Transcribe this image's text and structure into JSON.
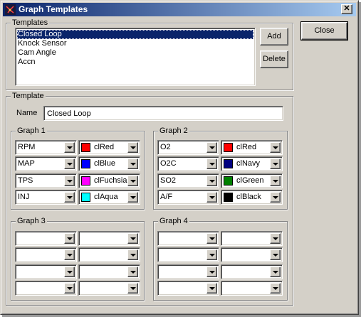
{
  "window": {
    "title": "Graph Templates",
    "close_glyph": "✕"
  },
  "buttons": {
    "close": "Close",
    "add": "Add",
    "delete": "Delete"
  },
  "templates_group": {
    "label": "Templates",
    "items": [
      "Closed Loop",
      "Knock Sensor",
      "Cam Angle",
      "Accn"
    ],
    "selected_index": 0
  },
  "template_group": {
    "label": "Template",
    "name_label": "Name",
    "name_value": "Closed Loop"
  },
  "graphs": [
    {
      "label": "Graph 1",
      "rows": [
        {
          "param": "RPM",
          "color_name": "clRed",
          "color": "#ff0000"
        },
        {
          "param": "MAP",
          "color_name": "clBlue",
          "color": "#0000ff"
        },
        {
          "param": "TPS",
          "color_name": "clFuchsia",
          "color": "#ff00ff"
        },
        {
          "param": "INJ",
          "color_name": "clAqua",
          "color": "#00ffff"
        }
      ]
    },
    {
      "label": "Graph 2",
      "rows": [
        {
          "param": "O2",
          "color_name": "clRed",
          "color": "#ff0000"
        },
        {
          "param": "O2C",
          "color_name": "clNavy",
          "color": "#000080"
        },
        {
          "param": "SO2",
          "color_name": "clGreen",
          "color": "#008000"
        },
        {
          "param": "A/F",
          "color_name": "clBlack",
          "color": "#000000"
        }
      ]
    },
    {
      "label": "Graph 3",
      "rows": [
        {
          "param": "",
          "color_name": "",
          "color": ""
        },
        {
          "param": "",
          "color_name": "",
          "color": ""
        },
        {
          "param": "",
          "color_name": "",
          "color": ""
        },
        {
          "param": "",
          "color_name": "",
          "color": ""
        }
      ]
    },
    {
      "label": "Graph 4",
      "rows": [
        {
          "param": "",
          "color_name": "",
          "color": ""
        },
        {
          "param": "",
          "color_name": "",
          "color": ""
        },
        {
          "param": "",
          "color_name": "",
          "color": ""
        },
        {
          "param": "",
          "color_name": "",
          "color": ""
        }
      ]
    }
  ]
}
